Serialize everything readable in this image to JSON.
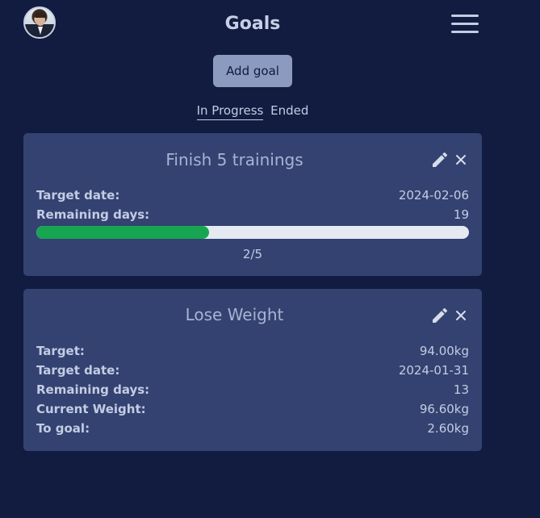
{
  "header": {
    "title": "Goals",
    "avatar_icon": "user-avatar",
    "menu_icon": "hamburger-menu-icon"
  },
  "actions": {
    "add_goal_label": "Add goal"
  },
  "tabs": [
    {
      "label": "In Progress",
      "active": true
    },
    {
      "label": "Ended",
      "active": false
    }
  ],
  "goals": [
    {
      "title": "Finish 5 trainings",
      "rows": [
        {
          "label": "Target date:",
          "value": "2024-02-06"
        },
        {
          "label": "Remaining days:",
          "value": "19"
        }
      ],
      "progress": {
        "current": 2,
        "total": 5,
        "text": "2/5",
        "fraction": 0.4
      }
    },
    {
      "title": "Lose Weight",
      "rows": [
        {
          "label": "Target:",
          "value": "94.00kg"
        },
        {
          "label": "Target date:",
          "value": "2024-01-31"
        },
        {
          "label": "Remaining days:",
          "value": "13"
        },
        {
          "label": "Current Weight:",
          "value": "96.60kg"
        },
        {
          "label": "To goal:",
          "value": "2.60kg"
        }
      ]
    }
  ],
  "colors": {
    "background": "#111c40",
    "card": "#334270",
    "progress_fill": "#18a552",
    "progress_track": "#e4e9f2",
    "button": "#8d9ac0"
  }
}
